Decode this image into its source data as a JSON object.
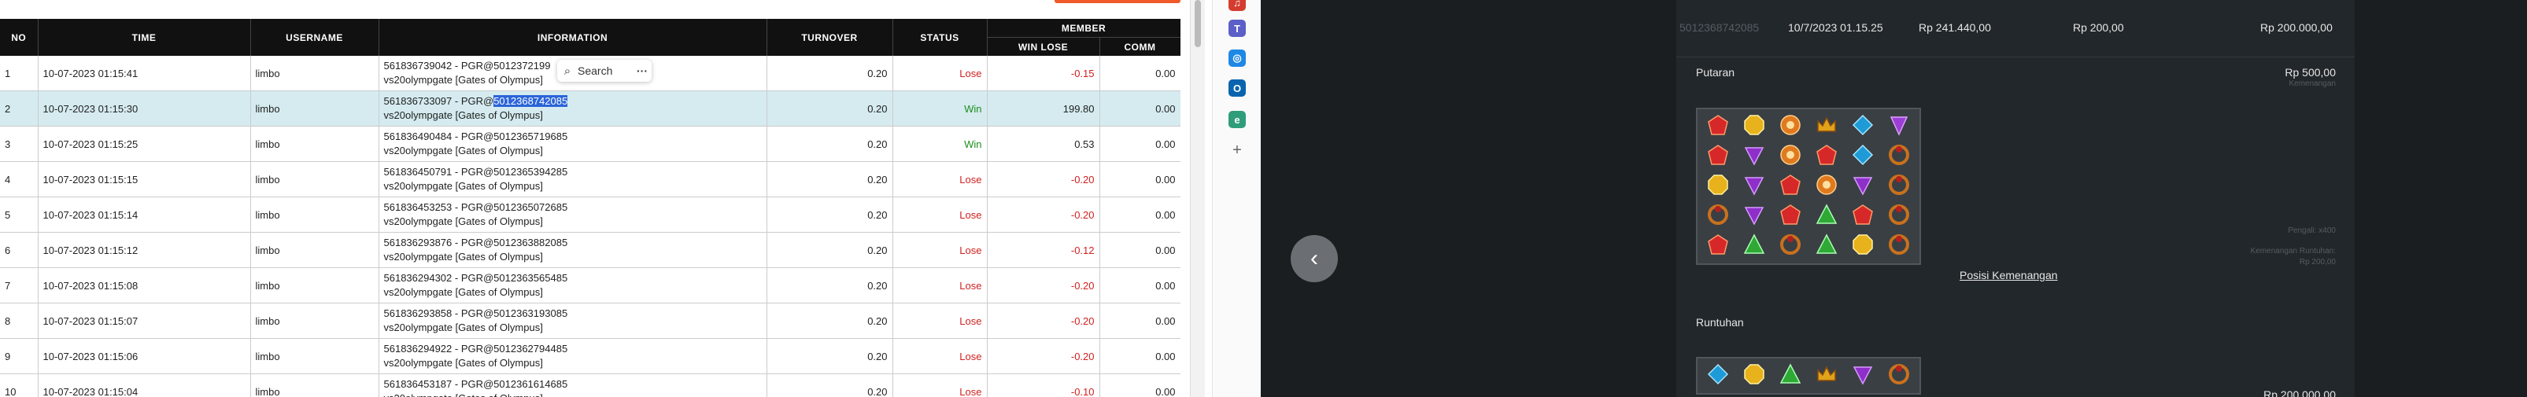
{
  "table": {
    "headers": {
      "no": "NO",
      "time": "TIME",
      "username": "USERNAME",
      "information": "INFORMATION",
      "turnover": "TURNOVER",
      "status": "STATUS",
      "member": "MEMBER",
      "winlose": "WIN LOSE",
      "comm": "COMM"
    },
    "rows": [
      {
        "no": "1",
        "time": "10-07-2023 01:15:41",
        "username": "limbo",
        "info1": "561836739042 - PGR@5012372199",
        "info2": "vs20olympgate [Gates of Olympus]",
        "turnover": "0.20",
        "status": "Lose",
        "winlose": "-0.15",
        "comm": "0.00"
      },
      {
        "no": "2",
        "time": "10-07-2023 01:15:30",
        "username": "limbo",
        "info1": "561836733097 - PGR@",
        "info1_hl": "5012368742085",
        "info2": "vs20olympgate [Gates of Olympus]",
        "turnover": "0.20",
        "status": "Win",
        "winlose": "199.80",
        "comm": "0.00"
      },
      {
        "no": "3",
        "time": "10-07-2023 01:15:25",
        "username": "limbo",
        "info1": "561836490484 - PGR@5012365719685",
        "info2": "vs20olympgate [Gates of Olympus]",
        "turnover": "0.20",
        "status": "Win",
        "winlose": "0.53",
        "comm": "0.00"
      },
      {
        "no": "4",
        "time": "10-07-2023 01:15:15",
        "username": "limbo",
        "info1": "561836450791 - PGR@5012365394285",
        "info2": "vs20olympgate [Gates of Olympus]",
        "turnover": "0.20",
        "status": "Lose",
        "winlose": "-0.20",
        "comm": "0.00"
      },
      {
        "no": "5",
        "time": "10-07-2023 01:15:14",
        "username": "limbo",
        "info1": "561836453253 - PGR@5012365072685",
        "info2": "vs20olympgate [Gates of Olympus]",
        "turnover": "0.20",
        "status": "Lose",
        "winlose": "-0.20",
        "comm": "0.00"
      },
      {
        "no": "6",
        "time": "10-07-2023 01:15:12",
        "username": "limbo",
        "info1": "561836293876 - PGR@5012363882085",
        "info2": "vs20olympgate [Gates of Olympus]",
        "turnover": "0.20",
        "status": "Lose",
        "winlose": "-0.12",
        "comm": "0.00"
      },
      {
        "no": "7",
        "time": "10-07-2023 01:15:08",
        "username": "limbo",
        "info1": "561836294302 - PGR@5012363565485",
        "info2": "vs20olympgate [Gates of Olympus]",
        "turnover": "0.20",
        "status": "Lose",
        "winlose": "-0.20",
        "comm": "0.00"
      },
      {
        "no": "8",
        "time": "10-07-2023 01:15:07",
        "username": "limbo",
        "info1": "561836293858 - PGR@5012363193085",
        "info2": "vs20olympgate [Gates of Olympus]",
        "turnover": "0.20",
        "status": "Lose",
        "winlose": "-0.20",
        "comm": "0.00"
      },
      {
        "no": "9",
        "time": "10-07-2023 01:15:06",
        "username": "limbo",
        "info1": "561836294922 - PGR@5012362794485",
        "info2": "vs20olympgate [Gates of Olympus]",
        "turnover": "0.20",
        "status": "Lose",
        "winlose": "-0.20",
        "comm": "0.00"
      },
      {
        "no": "10",
        "time": "10-07-2023 01:15:04",
        "username": "limbo",
        "info1": "561836453187 - PGR@5012361614685",
        "info2": "vs20olympgate [Gates of Olympus]",
        "turnover": "0.20",
        "status": "Lose",
        "winlose": "-0.10",
        "comm": "0.00"
      }
    ]
  },
  "context_menu": {
    "search_label": "Search",
    "more": "···"
  },
  "rail_icons": [
    "music-note-icon",
    "teams-icon",
    "copilot-icon",
    "outlook-icon",
    "edge-icon",
    "add-icon"
  ],
  "game_detail": {
    "round_id": "5012368742085",
    "datetime": "10/7/2023 01.15.25",
    "balance": "Rp 241.440,00",
    "bet": "Rp 200,00",
    "win": "Rp 200.000,00",
    "spin_title": "Putaran",
    "spin_amount": "Rp 500,00",
    "spin_amount_caption": "Kemenangan",
    "multiplier_caption": "Pengali: x400",
    "tumble_win_caption": "Kemenangan Runtuhan:",
    "tumble_win_value": "Rp 200,00",
    "win_position_link": "Posisi Kemenangan",
    "tumble_title": "Runtuhan",
    "tumble_amount": "Rp 200.000,00",
    "grid1": [
      [
        "red",
        "yellow",
        "orange",
        "crown",
        "blue",
        "hourglass"
      ],
      [
        "red",
        "purple",
        "orange",
        "red",
        "blue",
        "ring"
      ],
      [
        "yellow",
        "purple",
        "red",
        "orange",
        "purple",
        "ring"
      ],
      [
        "ring",
        "purple",
        "red",
        "green",
        "red",
        "ring"
      ],
      [
        "red",
        "green",
        "ring",
        "green",
        "yellow",
        "ring"
      ]
    ],
    "grid2": [
      [
        "blue",
        "yellow",
        "green",
        "crown",
        "purple",
        "ring"
      ]
    ]
  },
  "colors": {
    "lose": "#d21f1f",
    "win": "#1e8f1e",
    "selected_row": "#d5ebef",
    "highlight": "#2b64d9",
    "dark_bg": "#1a1e21",
    "panel_bg": "#22272b"
  }
}
